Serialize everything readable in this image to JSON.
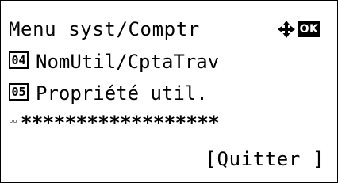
{
  "screen": {
    "title": "Menu syst/Comptr",
    "nav_icon": "four-way-arrow-icon",
    "ok_label": "OK"
  },
  "menu": {
    "items": [
      {
        "number": "04",
        "label": "NomUtil/CptaTrav"
      },
      {
        "number": "05",
        "label": "Propriété util."
      }
    ]
  },
  "input": {
    "cursor": "▫▫",
    "masked": "******************"
  },
  "softkey": {
    "label": "[Quitter ]"
  },
  "colors": {
    "foreground": "#000000",
    "background": "#ffffff"
  }
}
